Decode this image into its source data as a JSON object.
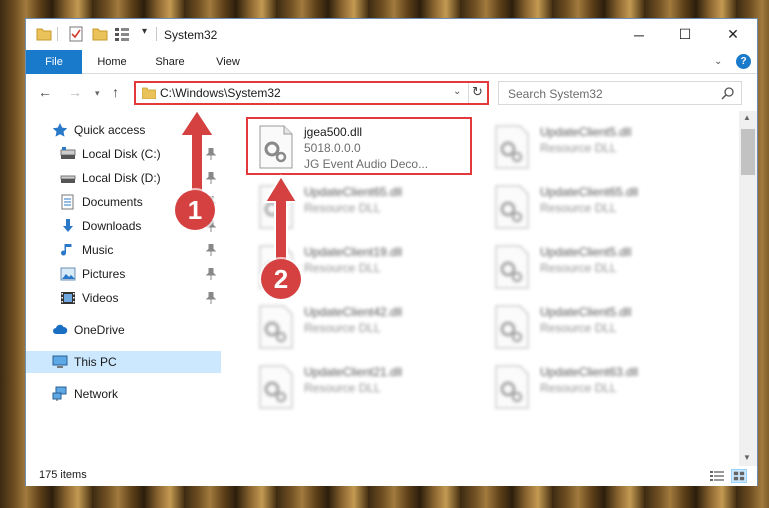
{
  "window": {
    "title": "System32",
    "controls": {
      "minimize": "─",
      "maximize": "☐",
      "close": "✕"
    }
  },
  "ribbon": {
    "tabs": [
      "File",
      "Home",
      "Share",
      "View"
    ],
    "help": "?"
  },
  "navigation": {
    "address": "C:\\Windows\\System32",
    "search_placeholder": "Search System32"
  },
  "sidebar": {
    "items": [
      {
        "label": "Quick access",
        "icon": "star-icon",
        "pinned": false
      },
      {
        "label": "Local Disk (C:)",
        "icon": "drive-icon",
        "pinned": true
      },
      {
        "label": "Local Disk (D:)",
        "icon": "drive-icon",
        "pinned": true
      },
      {
        "label": "Documents",
        "icon": "documents-icon",
        "pinned": true
      },
      {
        "label": "Downloads",
        "icon": "downloads-icon",
        "pinned": true
      },
      {
        "label": "Music",
        "icon": "music-icon",
        "pinned": true
      },
      {
        "label": "Pictures",
        "icon": "pictures-icon",
        "pinned": true
      },
      {
        "label": "Videos",
        "icon": "videos-icon",
        "pinned": true
      },
      {
        "label": "OneDrive",
        "icon": "onedrive-icon",
        "pinned": false
      },
      {
        "label": "This PC",
        "icon": "pc-icon",
        "pinned": false
      },
      {
        "label": "Network",
        "icon": "network-icon",
        "pinned": false
      }
    ]
  },
  "files": [
    {
      "name": "jgea500.dll",
      "line1": "5018.0.0.0",
      "line2": "JG Event Audio Deco..."
    },
    {
      "name": "UpdateClient5.dll",
      "line1": "Resource DLL"
    },
    {
      "name": "UpdateClient65.dll",
      "line1": "Resource DLL"
    },
    {
      "name": "UpdateClient65.dll",
      "line1": "Resource DLL"
    },
    {
      "name": "UpdateClient19.dll",
      "line1": "Resource DLL"
    },
    {
      "name": "UpdateClient5.dll",
      "line1": "Resource DLL"
    },
    {
      "name": "UpdateClient42.dll",
      "line1": "Resource DLL"
    },
    {
      "name": "UpdateClient5.dll",
      "line1": "Resource DLL"
    },
    {
      "name": "UpdateClient21.dll",
      "line1": "Resource DLL"
    },
    {
      "name": "UpdateClient63.dll",
      "line1": "Resource DLL"
    }
  ],
  "status": {
    "item_count": "175 items"
  },
  "annotations": {
    "step1": "1",
    "step2": "2"
  },
  "colors": {
    "accent": "#1979ca",
    "highlight": "#e23a3a",
    "callout": "#d44140",
    "selection": "#cce8ff"
  }
}
